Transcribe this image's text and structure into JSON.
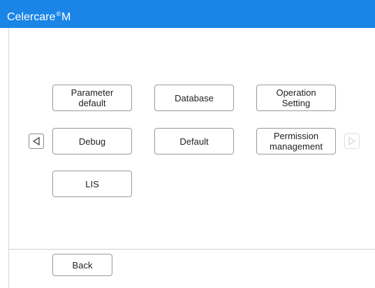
{
  "app": {
    "name": "Celercare",
    "registered_mark": "®",
    "model": "M"
  },
  "menu": {
    "buttons": [
      {
        "label": "Parameter\ndefault"
      },
      {
        "label": "Database"
      },
      {
        "label": "Operation\nSetting"
      },
      {
        "label": "Debug"
      },
      {
        "label": "Default"
      },
      {
        "label": "Permission\nmanagement"
      },
      {
        "label": "LIS"
      }
    ],
    "prev_icon": "triangle-left-icon",
    "next_icon": "triangle-right-icon",
    "next_enabled": false
  },
  "footer": {
    "back_label": "Back"
  }
}
